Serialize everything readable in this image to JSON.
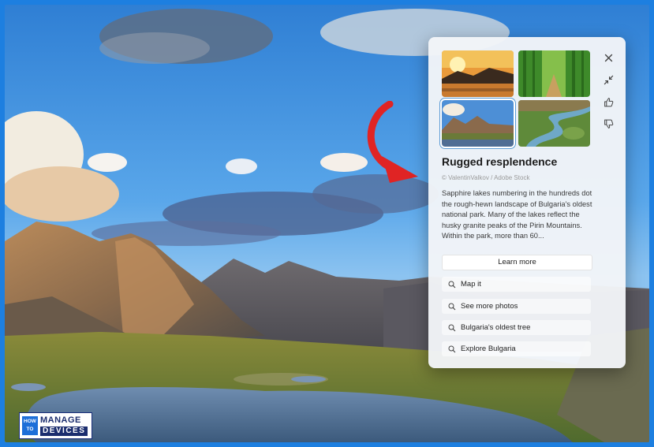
{
  "spotlight": {
    "title": "Rugged resplendence",
    "credit": "© ValentinValkov / Adobe Stock",
    "description": "Sapphire lakes numbering in the hundreds dot the rough-hewn landscape of Bulgaria's oldest national park. Many of the lakes reflect the husky granite peaks of the Pirin Mountains. Within the park, more than 60...",
    "learn_more_label": "Learn more",
    "links": [
      "Map it",
      "See more photos",
      "Bulgaria's oldest tree",
      "Explore Bulgaria"
    ],
    "controls": [
      "close-icon",
      "collapse-icon",
      "thumbs-up-icon",
      "thumbs-down-icon"
    ],
    "thumbnails": [
      "sunset-lake",
      "bamboo-forest",
      "mountain-lake",
      "river-valley"
    ],
    "selected_thumbnail": 2
  },
  "logo": {
    "how": "HOW",
    "to": "TO",
    "manage": "MANAGE",
    "devices": "DEVICES"
  },
  "colors": {
    "frame_border": "#1d7fe0",
    "arrow": "#e02424",
    "logo_navy": "#1b2d6e",
    "logo_blue": "#1d6fd8"
  }
}
